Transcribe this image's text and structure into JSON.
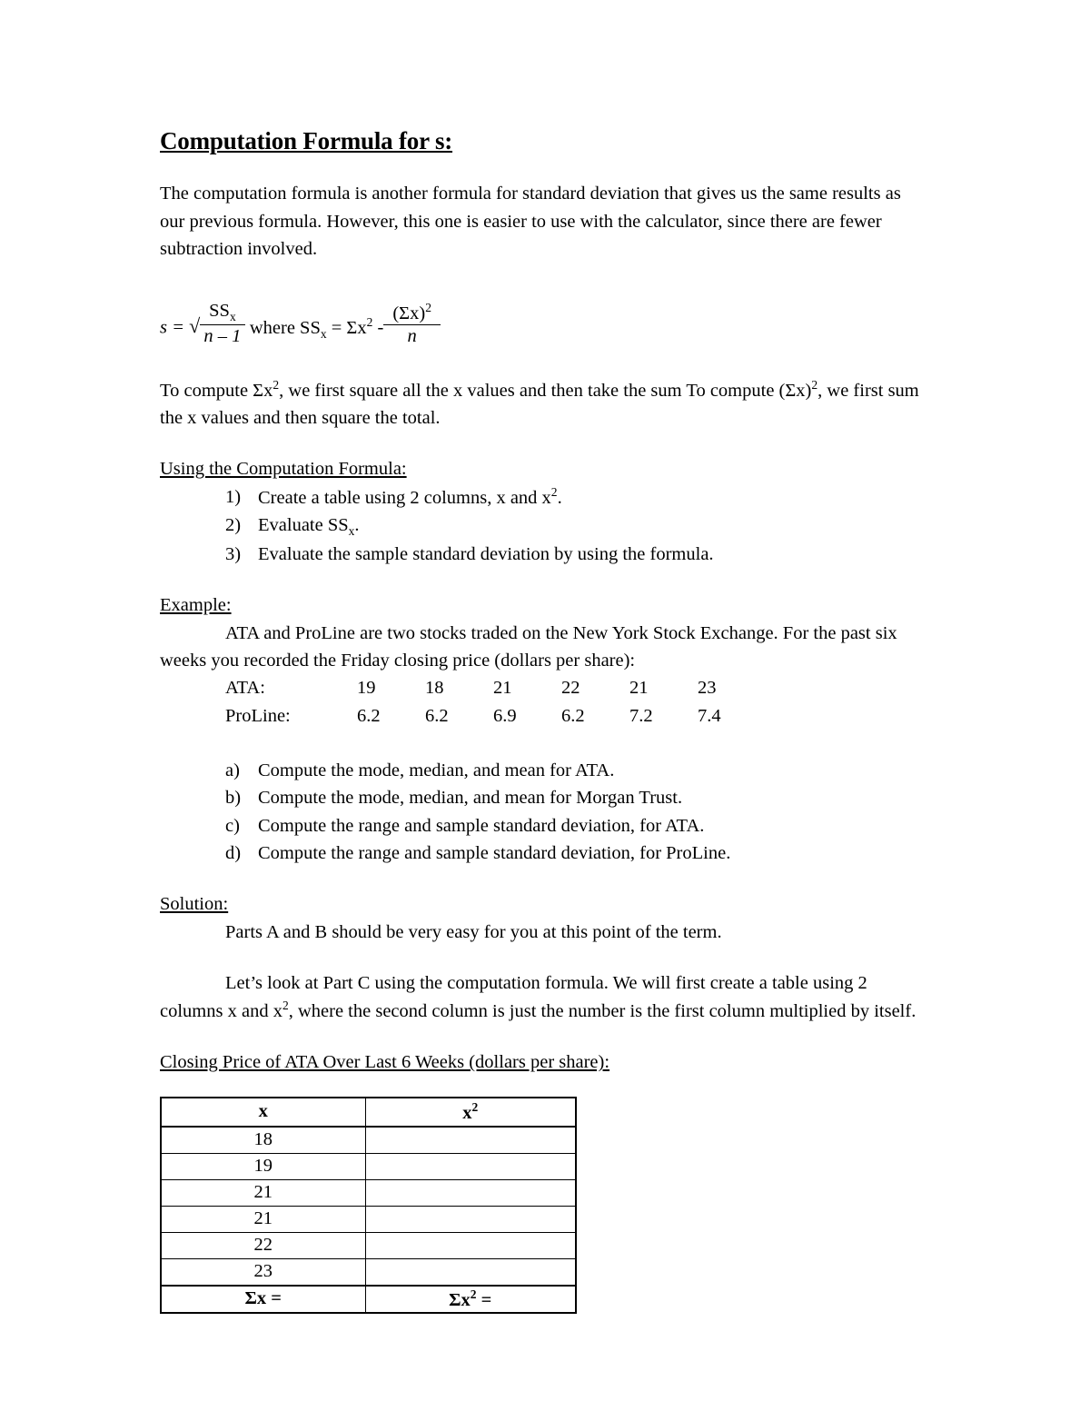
{
  "document": {
    "title": "Computation Formula for s:",
    "intro_paragraph": "The computation formula is another formula for standard deviation that gives us the same results as our previous formula.  However, this one is easier to use with the calculator, since there are fewer subtraction involved.",
    "formula": {
      "lhs": "s =",
      "radical": "√",
      "frac1_numerator": "SS",
      "frac1_numerator_sub": "x",
      "frac1_denominator": "n – 1",
      "where_text": "where SS",
      "where_sub": "x",
      "equals": "= Σx",
      "equals_sup": "2",
      "minus": "-",
      "frac2_numerator": "(Σx)",
      "frac2_numerator_sup": "2",
      "frac2_denominator": "n"
    },
    "compute_paragraph_part1": "To compute Σx",
    "compute_paragraph_sup1": "2",
    "compute_paragraph_part2": ", we first square all the x values and then take the sum   To compute (Σx)",
    "compute_paragraph_sup2": "2",
    "compute_paragraph_part3": ", we first sum the x values and then square the total.",
    "using_heading": "Using the Computation Formula:",
    "using_steps": [
      {
        "marker": "1)",
        "text_before": "Create a table using 2 columns, x and x",
        "sup": "2",
        "text_after": "."
      },
      {
        "marker": "2)",
        "text_before": "Evaluate SS",
        "sub": "x",
        "text_after": "."
      },
      {
        "marker": "3)",
        "text_before": "Evaluate the sample standard deviation by using the formula.",
        "sup": "",
        "text_after": ""
      }
    ],
    "example_heading": "Example:",
    "example_paragraph": "ATA and ProLine are two stocks traded on the New York Stock Exchange.  For the past six weeks you recorded the Friday closing price (dollars per share):",
    "stock_rows": [
      {
        "label": "ATA:",
        "values": [
          "19",
          "18",
          "21",
          "22",
          "21",
          "23"
        ]
      },
      {
        "label": "ProLine:",
        "values": [
          "6.2",
          "6.2",
          "6.9",
          "6.2",
          "7.2",
          "7.4"
        ]
      }
    ],
    "questions": [
      {
        "marker": "a)",
        "text": "Compute the mode, median, and mean for ATA."
      },
      {
        "marker": "b)",
        "text": "Compute the mode, median, and mean for Morgan Trust."
      },
      {
        "marker": "c)",
        "text": "Compute the range and sample standard deviation, for ATA."
      },
      {
        "marker": "d)",
        "text": "Compute the range and sample standard deviation, for ProLine."
      }
    ],
    "solution_heading": "Solution:",
    "solution_paragraph_1": "Parts A and B should be very easy for you at this point of the term.",
    "solution_paragraph_2_part1": "Let’s look at Part C using the computation formula.  We will first create a table using 2 columns x and x",
    "solution_paragraph_2_sup": "2",
    "solution_paragraph_2_part2": ", where the second column is just the number is the first column multiplied by itself.",
    "table_caption": "Closing Price of ATA Over Last 6 Weeks (dollars per share):"
  },
  "chart_data": {
    "type": "table",
    "title": "Closing Price of ATA Over Last 6 Weeks (dollars per share):",
    "columns": [
      "x",
      "x²"
    ],
    "column_headers_plain": [
      "x",
      "x2"
    ],
    "rows": [
      {
        "x": "18",
        "x2": ""
      },
      {
        "x": "19",
        "x2": ""
      },
      {
        "x": "21",
        "x2": ""
      },
      {
        "x": "21",
        "x2": ""
      },
      {
        "x": "22",
        "x2": ""
      },
      {
        "x": "23",
        "x2": ""
      }
    ],
    "totals_row": {
      "x_label": "Σx =",
      "x2_label": "Σx² =",
      "x_value": "",
      "x2_value": ""
    }
  }
}
